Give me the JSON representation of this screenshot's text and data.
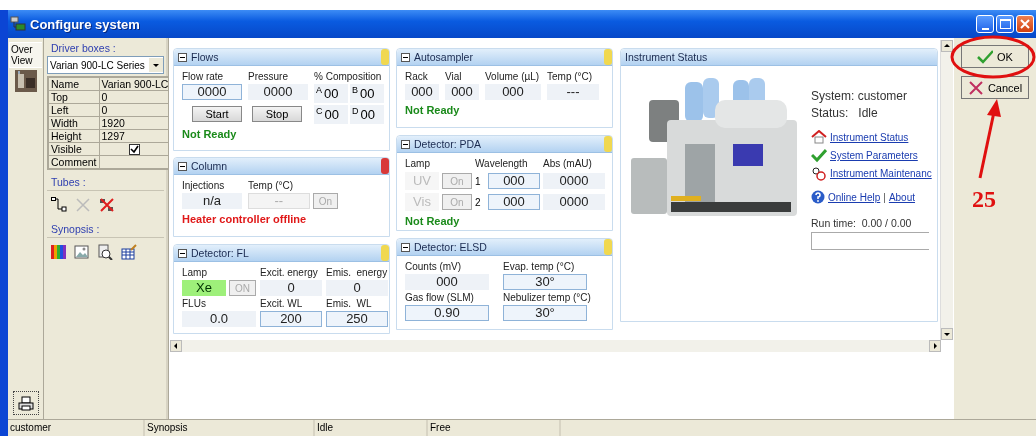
{
  "window": {
    "title": "Configure system"
  },
  "side_tabs": [
    {
      "label": "Over View",
      "selected": true
    }
  ],
  "driver_boxes": {
    "label": "Driver boxes :",
    "selection": "Varian 900-LC Series",
    "properties": [
      {
        "name": "Name",
        "value": "Varian 900-LC"
      },
      {
        "name": "Top",
        "value": "0"
      },
      {
        "name": "Left",
        "value": "0"
      },
      {
        "name": "Width",
        "value": "1920"
      },
      {
        "name": "Height",
        "value": "1297"
      },
      {
        "name": "Visible",
        "kind": "checkbox",
        "checked": true
      },
      {
        "name": "Comment"
      }
    ]
  },
  "tubes": {
    "label": "Tubes :"
  },
  "synopsis": {
    "label": "Synopsis :"
  },
  "panel_columns": [
    [
      {
        "kind": "flows",
        "title": "Flows",
        "color": "#f0d850",
        "fields": [
          {
            "label": "Flow rate",
            "value": "0000",
            "editable": true
          },
          {
            "label": "Pressure",
            "value": "0000",
            "editable": false
          }
        ],
        "composition": {
          "label": "% Composition",
          "channels": [
            {
              "letter": "A",
              "value": "00"
            },
            {
              "letter": "B",
              "value": "00"
            },
            {
              "letter": "C",
              "value": "00"
            },
            {
              "letter": "D",
              "value": "00"
            }
          ]
        },
        "buttons": [
          "Start",
          "Stop"
        ],
        "status": {
          "text": "Not Ready",
          "color": "#1a8a1a"
        }
      },
      {
        "kind": "column",
        "title": "Column",
        "color": "#d83838",
        "fields": [
          {
            "label": "Injections",
            "value": "n/a",
            "editable": false
          },
          {
            "label": "Temp (°C)",
            "value": "--",
            "disabled": true,
            "toggle": {
              "label": "On",
              "disabled": true
            }
          }
        ],
        "status": {
          "text": "Heater controller offline",
          "color": "#e01818"
        }
      },
      {
        "kind": "fl",
        "title": "Detector: FL",
        "color": "#f0d850",
        "fields": [
          {
            "label": "Lamp",
            "value": "Xe",
            "lit": true,
            "toggle": {
              "label": "ON",
              "disabled": true
            }
          },
          {
            "label": "Excit. energy",
            "value": "0",
            "editable": false
          },
          {
            "label": "Emis.  energy",
            "value": "0",
            "editable": false
          },
          {
            "label": "FLUs",
            "value": "0.0",
            "editable": false
          },
          {
            "label": "Excit. WL",
            "value": "200",
            "editable": true
          },
          {
            "label": "Emis.  WL",
            "value": "250",
            "editable": true
          }
        ]
      }
    ],
    [
      {
        "kind": "autosampler",
        "title": "Autosampler",
        "color": "#f0d850",
        "fields": [
          {
            "label": "Rack",
            "value": "000",
            "editable": false
          },
          {
            "label": "Vial",
            "value": "000",
            "editable": false
          },
          {
            "label": "Volume (µL)",
            "value": "000",
            "editable": false
          },
          {
            "label": "Temp (°C)",
            "value": "---",
            "editable": false
          }
        ],
        "status": {
          "text": "Not Ready",
          "color": "#1a8a1a"
        }
      },
      {
        "kind": "pda",
        "title": "Detector: PDA",
        "color": "#f0d850",
        "headers": [
          "Lamp",
          "Wavelength",
          "Abs (mAU)"
        ],
        "rows": [
          {
            "lamp": "UV",
            "toggle": "On",
            "index": "1",
            "wavelength": "000",
            "abs": "0000"
          },
          {
            "lamp": "Vis",
            "toggle": "On",
            "index": "2",
            "wavelength": "000",
            "abs": "0000"
          }
        ],
        "status": {
          "text": "Not Ready",
          "color": "#1a8a1a"
        }
      },
      {
        "kind": "elsd",
        "title": "Detector: ELSD",
        "color": "#f0d850",
        "fields": [
          {
            "label": "Counts (mV)",
            "value": "000",
            "editable": false
          },
          {
            "label": "Evap. temp (°C)",
            "value": "30°",
            "editable": true
          },
          {
            "label": "Gas flow (SLM)",
            "value": "0.90",
            "editable": true
          },
          {
            "label": "Nebulizer temp (°C)",
            "value": "30°",
            "editable": true
          }
        ]
      }
    ],
    [
      {
        "kind": "status",
        "title": "Instrument Status",
        "picture": {
          "kind": "picture"
        },
        "lines": [
          "System: customer",
          "Status:   Idle"
        ],
        "links": [
          {
            "kind": "home",
            "label": "Instrument Status"
          },
          {
            "kind": "check",
            "label": "System Parameters"
          },
          {
            "kind": "maintenance",
            "label": "Instrument Maintenanc"
          }
        ],
        "help_links": [
          "Online Help",
          "About"
        ],
        "help_separator": "|",
        "run_time": "Run time:  0.00 / 0.00"
      }
    ]
  ],
  "buttons": [
    {
      "kind": "ok",
      "label": "OK"
    },
    {
      "kind": "cancel",
      "label": "Cancel"
    }
  ],
  "status_bar": [
    "customer",
    "Synopsis",
    "Idle",
    "Free"
  ],
  "annotation": {
    "label": "25"
  }
}
